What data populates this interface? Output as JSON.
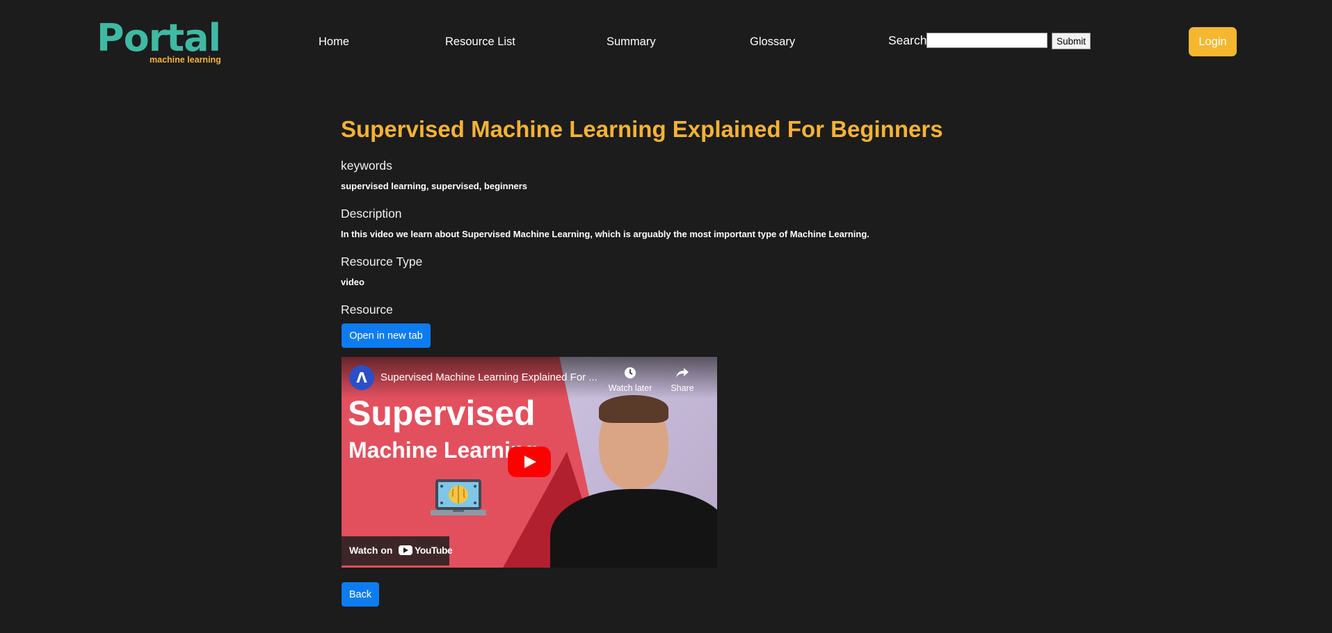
{
  "header": {
    "logo": {
      "main": "Portal",
      "sub": "machine learning"
    },
    "nav": [
      {
        "label": "Home"
      },
      {
        "label": "Resource List"
      },
      {
        "label": "Summary"
      },
      {
        "label": "Glossary"
      }
    ],
    "search": {
      "label": "Search",
      "value": "",
      "submit_label": "Submit"
    },
    "login_label": "Login"
  },
  "resource": {
    "title": "Supervised Machine Learning Explained For Beginners",
    "keywords_label": "keywords",
    "keywords": "supervised learning, supervised, beginners",
    "description_label": "Description",
    "description": "In this video we learn about Supervised Machine Learning, which is arguably the most important type of Machine Learning.",
    "type_label": "Resource Type",
    "type": "video",
    "resource_label": "Resource",
    "open_new_tab_label": "Open in new tab",
    "back_label": "Back"
  },
  "video": {
    "title": "Supervised Machine Learning Explained For ...",
    "watch_later_label": "Watch later",
    "share_label": "Share",
    "thumbnail_line1": "Supervised",
    "thumbnail_line2": "Machine Learning",
    "watch_on_label": "Watch on",
    "youtube_label": "YouTube"
  },
  "colors": {
    "background": "#1c1c1c",
    "logo_teal": "#3fb9a3",
    "accent_orange": "#f5b235",
    "button_blue": "#0d7cf0",
    "youtube_red": "#ff0000"
  }
}
